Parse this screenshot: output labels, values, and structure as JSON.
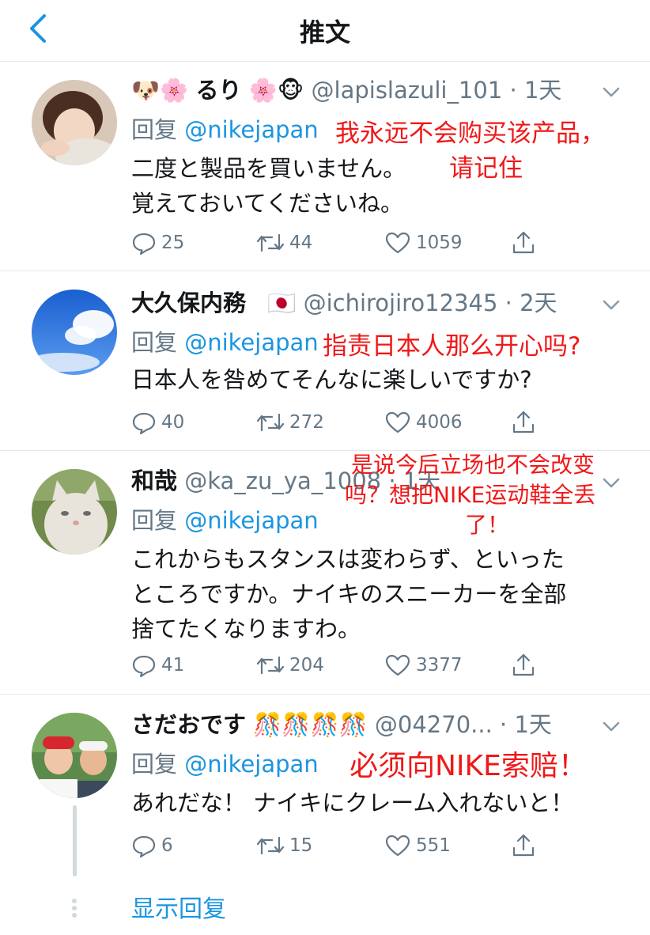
{
  "header": {
    "title": "推文",
    "back_icon": "chevron-left-icon"
  },
  "colors": {
    "accent": "#1b95e0",
    "secondary": "#657786",
    "annotation": "#f01818"
  },
  "tweets": [
    {
      "emoji_prefix": "🐶🌸",
      "name": "るり",
      "emoji_suffix": "🌸🐵",
      "handle": "@lapislazuli_101 · 1天",
      "reply_prefix": "回复 ",
      "reply_to": "@nikejapan",
      "text": "二度と製品を買いません。\n覚えておいてくださいね。",
      "replies": "25",
      "retweets": "44",
      "likes": "1059",
      "annotation": "我永远不会购买该产品，",
      "annotation2": "请记住"
    },
    {
      "name": "大久保内務",
      "emoji_suffix": "🇯🇵",
      "handle": "@ichirojiro12345 · 2天",
      "reply_prefix": "回复 ",
      "reply_to": "@nikejapan",
      "text": "日本人を咎めてそんなに楽しいですか?",
      "replies": "40",
      "retweets": "272",
      "likes": "4006",
      "annotation": "指责日本人那么开心吗?"
    },
    {
      "name": "和哉",
      "handle": "@ka_zu_ya_1008 · 1天",
      "reply_prefix": "回复 ",
      "reply_to": "@nikejapan",
      "text": "これからもスタンスは変わらず、といった\nところですか。ナイキのスニーカーを全部\n捨てたくなりますわ。",
      "replies": "41",
      "retweets": "204",
      "likes": "3377",
      "annotation": "是说今后立场也不会改变",
      "annotation2": "吗？想把NIKE运动鞋全丢",
      "annotation3": "了！"
    },
    {
      "name": "さだおです",
      "emoji_suffix": "🎊🎊🎊🎊",
      "handle": "@04270... · 1天",
      "reply_prefix": "回复 ",
      "reply_to": "@nikejapan",
      "text": "あれだな！ ナイキにクレーム入れないと！",
      "replies": "6",
      "retweets": "15",
      "likes": "551",
      "annotation": "必须向NIKE索赔！"
    }
  ],
  "show_replies": "显示回复"
}
